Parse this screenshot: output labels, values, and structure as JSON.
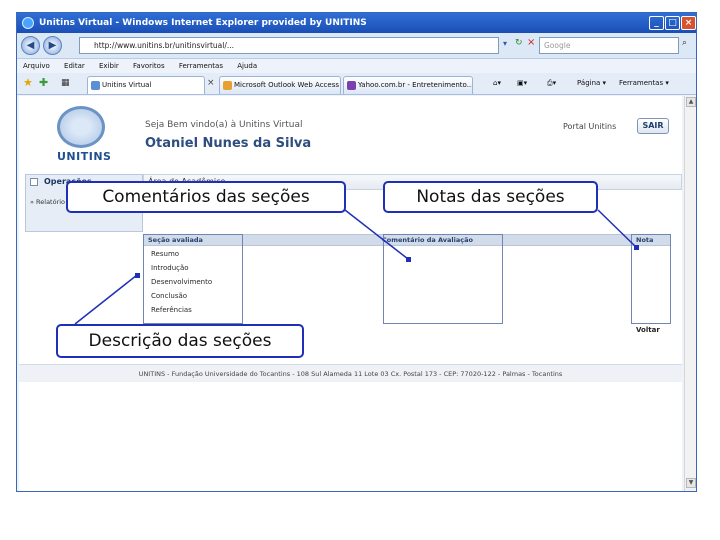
{
  "browser": {
    "title": "Unitins Virtual - Windows Internet Explorer provided by UNITINS",
    "url": "http://www.unitins.br/unitinsvirtual/...",
    "search_placeholder": "Google",
    "menu": [
      "Arquivo",
      "Editar",
      "Exibir",
      "Favoritos",
      "Ferramentas",
      "Ajuda"
    ],
    "tabs": [
      "Unitins Virtual",
      "Microsoft Outlook Web Access",
      "Yahoo.com.br - Entretenimento..."
    ],
    "commands": {
      "page": "Página",
      "tools": "Ferramentas"
    }
  },
  "page": {
    "logo_text": "UNITINS",
    "welcome": "Seja Bem vindo(a) à Unitins Virtual",
    "username": "Otaniel Nunes da Silva",
    "portal_link": "Portal Unitins",
    "exit_button": "SAIR",
    "operations_title": "Operações",
    "operations_sub": "» Relatório",
    "area_title": "Área do Acadêmico",
    "columns": {
      "section": "Seção avaliada",
      "comment": "Comentário da Avaliação",
      "grade": "Nota"
    },
    "sections": [
      "Resumo",
      "Introdução",
      "Desenvolvimento",
      "Conclusão",
      "Referências"
    ],
    "back_link": "Voltar",
    "footer": "UNITINS - Fundação Universidade do Tocantins - 108 Sul Alameda 11 Lote 03 Cx. Postal 173 - CEP: 77020-122 - Palmas - Tocantins"
  },
  "callouts": {
    "comments": "Comentários das seções",
    "grades": "Notas das seções",
    "descriptions": "Descrição das seções"
  },
  "colors": {
    "callout_border": "#1f2fb8",
    "title_bar": "#2f6fd6"
  }
}
